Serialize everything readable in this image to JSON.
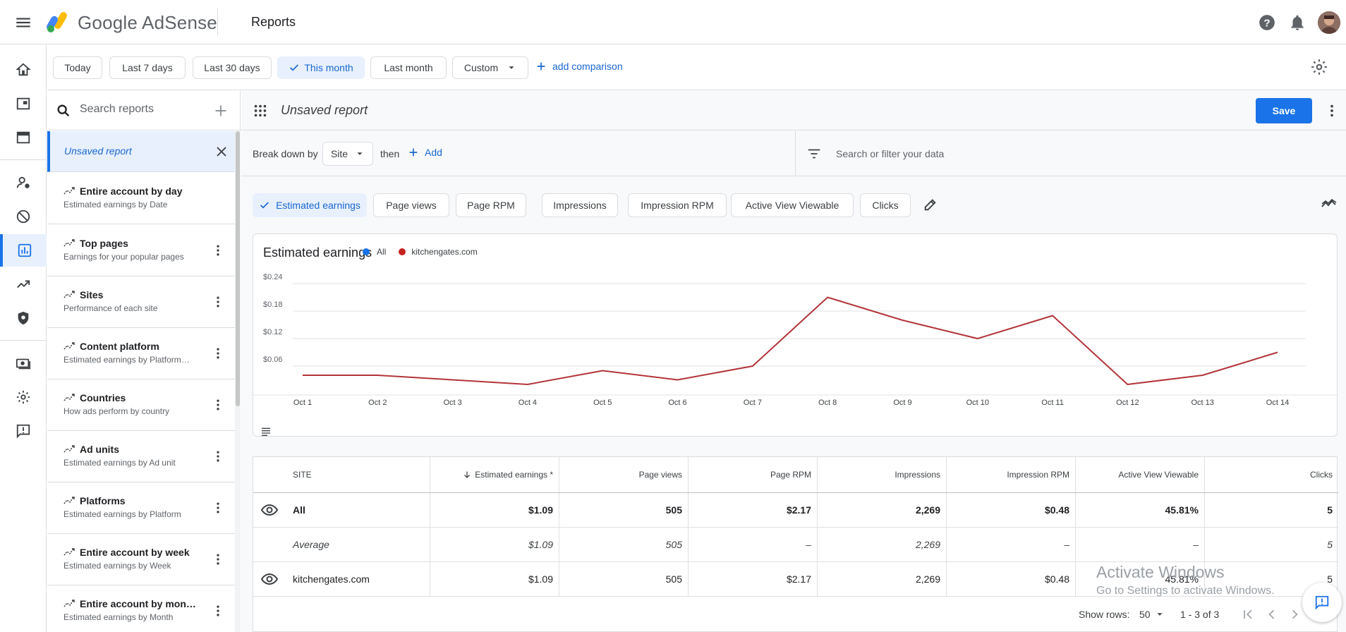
{
  "header": {
    "brand_google": "Google",
    "brand_product": "AdSense",
    "page_title": "Reports"
  },
  "date_ranges": [
    {
      "label": "Today",
      "selected": false
    },
    {
      "label": "Last 7 days",
      "selected": false
    },
    {
      "label": "Last 30 days",
      "selected": false
    },
    {
      "label": "This month",
      "selected": true
    },
    {
      "label": "Last month",
      "selected": false
    },
    {
      "label": "Custom",
      "selected": false
    }
  ],
  "add_comparison": "add comparison",
  "sidebar": {
    "search_placeholder": "Search reports",
    "unsaved_label": "Unsaved report",
    "reports": [
      {
        "title": "Entire account by day",
        "subtitle": "Estimated earnings by Date"
      },
      {
        "title": "Top pages",
        "subtitle": "Earnings for your popular pages"
      },
      {
        "title": "Sites",
        "subtitle": "Performance of each site"
      },
      {
        "title": "Content platform",
        "subtitle": "Estimated earnings by Platform…"
      },
      {
        "title": "Countries",
        "subtitle": "How ads perform by country"
      },
      {
        "title": "Ad units",
        "subtitle": "Estimated earnings by Ad unit"
      },
      {
        "title": "Platforms",
        "subtitle": "Estimated earnings by Platform"
      },
      {
        "title": "Entire account by week",
        "subtitle": "Estimated earnings by Week"
      },
      {
        "title": "Entire account by mon…",
        "subtitle": "Estimated earnings by Month"
      }
    ]
  },
  "report": {
    "name": "Unsaved report",
    "save_label": "Save",
    "breakdown_label": "Break down by",
    "breakdown_value": "Site",
    "then_label": "then",
    "add_label": "Add",
    "filter_placeholder": "Search or filter your data"
  },
  "metrics": [
    {
      "label": "Estimated earnings",
      "selected": true
    },
    {
      "label": "Page views",
      "selected": false
    },
    {
      "label": "Page RPM",
      "selected": false
    },
    {
      "label": "Impressions",
      "selected": false
    },
    {
      "label": "Impression RPM",
      "selected": false
    },
    {
      "label": "Active View Viewable",
      "selected": false
    },
    {
      "label": "Clicks",
      "selected": false
    }
  ],
  "chart_data": {
    "type": "line",
    "title": "Estimated earnings",
    "legend": [
      {
        "name": "All",
        "color": "#1a73e8"
      },
      {
        "name": "kitchengates.com",
        "color": "#c5221f"
      }
    ],
    "categories": [
      "Oct 1",
      "Oct 2",
      "Oct 3",
      "Oct 4",
      "Oct 5",
      "Oct 6",
      "Oct 7",
      "Oct 8",
      "Oct 9",
      "Oct 10",
      "Oct 11",
      "Oct 12",
      "Oct 13",
      "Oct 14"
    ],
    "y_ticks": [
      "$0.06",
      "$0.12",
      "$0.18",
      "$0.24"
    ],
    "ylim": [
      0,
      0.24
    ],
    "series": [
      {
        "name": "kitchengates.com",
        "color": "#b3353a",
        "values": [
          0.04,
          0.04,
          0.03,
          0.02,
          0.05,
          0.03,
          0.06,
          0.21,
          0.16,
          0.12,
          0.17,
          0.02,
          0.04,
          0.09
        ]
      }
    ],
    "grid": true,
    "legend_position": "top-left"
  },
  "table": {
    "columns": [
      "SITE",
      "Estimated earnings *",
      "Page views",
      "Page RPM",
      "Impressions",
      "Impression RPM",
      "Active View Viewable",
      "Clicks"
    ],
    "rows": [
      {
        "site": "All",
        "cells": [
          "$1.09",
          "505",
          "$2.17",
          "2,269",
          "$0.48",
          "45.81%",
          "5"
        ]
      },
      {
        "site": "Average",
        "cells": [
          "$1.09",
          "505",
          "–",
          "2,269",
          "–",
          "–",
          "5"
        ]
      },
      {
        "site": "kitchengates.com",
        "cells": [
          "$1.09",
          "505",
          "$2.17",
          "2,269",
          "$0.48",
          "45.81%",
          "5"
        ]
      }
    ],
    "show_rows_label": "Show rows:",
    "show_rows_value": "50",
    "pagination": "1 - 3 of 3"
  },
  "watermark": {
    "line1": "Activate Windows",
    "line2": "Go to Settings to activate Windows."
  }
}
